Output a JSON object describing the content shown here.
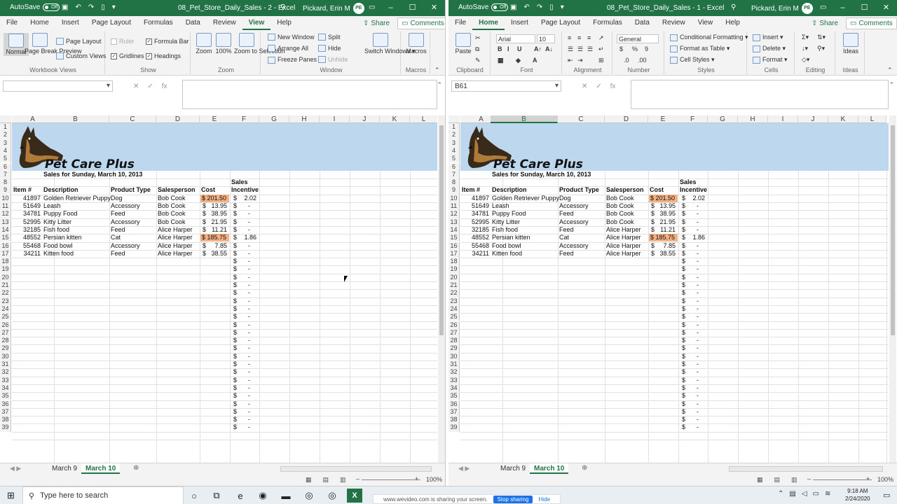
{
  "colors": {
    "excel_green": "#217346",
    "banner": "#bdd7ee",
    "highlight": "#f4b183"
  },
  "windows": [
    {
      "id": "L",
      "autosave_label": "AutoSave",
      "autosave_state": "Off",
      "title": "08_Pet_Store_Daily_Sales  -  2  -  Excel",
      "user": "Pickard, Erin M",
      "initials": "PE",
      "active_tab": "View",
      "tabs": [
        "File",
        "Home",
        "Insert",
        "Page Layout",
        "Formulas",
        "Data",
        "Review",
        "View",
        "Help"
      ],
      "share": "Share",
      "comments": "Comments",
      "ribbon": {
        "workbook_views": {
          "label": "Workbook Views",
          "normal": "Normal",
          "page_break": "Page Break Preview",
          "page_layout": "Page Layout",
          "custom": "Custom Views"
        },
        "show": {
          "label": "Show",
          "ruler": "Ruler",
          "formula_bar": "Formula Bar",
          "gridlines": "Gridlines",
          "headings": "Headings"
        },
        "zoom": {
          "label": "Zoom",
          "zoom": "Zoom",
          "hundred": "100%",
          "to_selection": "Zoom to Selection"
        },
        "window": {
          "label": "Window",
          "new_window": "New Window",
          "arrange_all": "Arrange All",
          "freeze": "Freeze Panes",
          "split": "Split",
          "hide": "Hide",
          "unhide": "Unhide",
          "switch": "Switch Windows"
        },
        "macros": {
          "label": "Macros",
          "macros": "Macros"
        }
      },
      "name_box": "",
      "active_sheet": "March 10",
      "zoom": "100%"
    },
    {
      "id": "R",
      "autosave_label": "AutoSave",
      "autosave_state": "Off",
      "title": "08_Pet_Store_Daily_Sales  -  1  -  Excel",
      "user": "Pickard, Erin M",
      "initials": "PE",
      "active_tab": "Home",
      "tabs": [
        "File",
        "Home",
        "Insert",
        "Page Layout",
        "Formulas",
        "Data",
        "Review",
        "View",
        "Help"
      ],
      "share": "Share",
      "comments": "Comments",
      "ribbon": {
        "clipboard": {
          "label": "Clipboard",
          "paste": "Paste"
        },
        "font": {
          "label": "Font",
          "name": "Arial",
          "size": "10"
        },
        "alignment": {
          "label": "Alignment"
        },
        "number": {
          "label": "Number",
          "format": "General"
        },
        "styles": {
          "label": "Styles",
          "conditional": "Conditional Formatting",
          "table": "Format as Table",
          "cell": "Cell Styles"
        },
        "cells": {
          "label": "Cells",
          "insert": "Insert",
          "delete": "Delete",
          "format": "Format"
        },
        "editing": {
          "label": "Editing"
        },
        "ideas": {
          "label": "Ideas",
          "ideas": "Ideas"
        }
      },
      "name_box": "B61",
      "active_sheet": "March 10",
      "zoom": "100%"
    }
  ],
  "sheet": {
    "company": "Pet Care Plus",
    "subtitle": "Sales for Sunday, March 10, 2013",
    "columns": [
      "A",
      "B",
      "C",
      "D",
      "E",
      "F",
      "G",
      "H",
      "I",
      "J",
      "K",
      "L"
    ],
    "headers": {
      "item": "Item #",
      "desc": "Description",
      "type": "Product Type",
      "sales": "Salesperson",
      "cost": "Cost",
      "inc1": "Sales",
      "inc2": "Incentive"
    },
    "rows": [
      [
        "41897",
        "Golden Retriever Puppy",
        "Dog",
        "Bob Cook",
        "$ 201.50",
        "$",
        "2.02"
      ],
      [
        "51649",
        "Leash",
        "Accessory",
        "Bob Cook",
        "$",
        "13.95",
        "$",
        "-"
      ],
      [
        "34781",
        "Puppy Food",
        "Feed",
        "Bob Cook",
        "$",
        "38.95",
        "$",
        "-"
      ],
      [
        "52995",
        "Kitty Litter",
        "Accessory",
        "Bob Cook",
        "$",
        "21.95",
        "$",
        "-"
      ],
      [
        "32185",
        "Fish food",
        "Feed",
        "Alice Harper",
        "$",
        "11.21",
        "$",
        "-"
      ],
      [
        "48552",
        "Persian kitten",
        "Cat",
        "Alice Harper",
        "$ 185.75",
        "$",
        "1.86"
      ],
      [
        "55468",
        "Food bowl",
        "Accessory",
        "Alice Harper",
        "$",
        "7.85",
        "$",
        "-"
      ],
      [
        "34211",
        "Kitten food",
        "Feed",
        "Alice Harper",
        "$",
        "38.55",
        "$",
        "-"
      ]
    ],
    "dash_symbol": "$",
    "dash_value": "-",
    "tabs": [
      "March 9",
      "March 10"
    ]
  },
  "taskbar": {
    "search_placeholder": "Type here to search",
    "time": "9:18 AM",
    "date": "2/24/2020"
  },
  "share_notice": {
    "text": "www.wevideo.com is sharing your screen.",
    "stop": "Stop sharing",
    "hide": "Hide"
  }
}
